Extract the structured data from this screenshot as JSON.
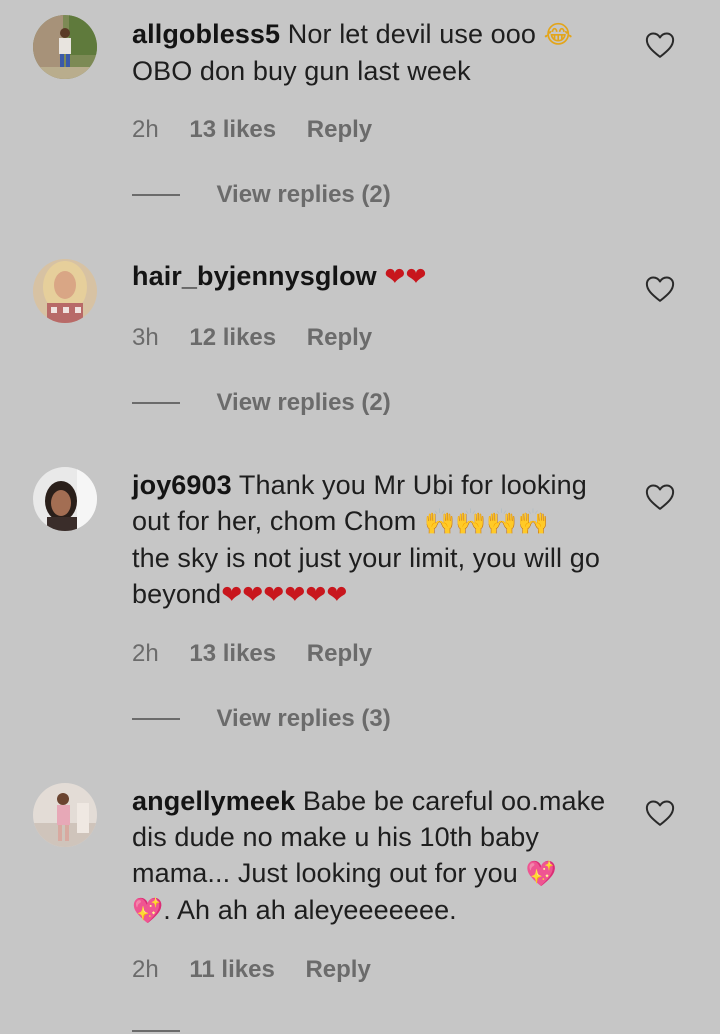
{
  "comments": [
    {
      "username": "allgobless5",
      "lines": [
        "Nor let devil use ooo",
        "OBO don buy gun last week"
      ],
      "emoji": "😂",
      "time": "2h",
      "likes": "13 likes",
      "reply": "Reply",
      "view_replies": "View replies (2)"
    },
    {
      "username": "hair_byjennysglow",
      "emoji": "❤❤",
      "time": "3h",
      "likes": "12 likes",
      "reply": "Reply",
      "view_replies": "View replies (2)"
    },
    {
      "username": "joy6903",
      "line1": "Thank you Mr Ubi for looking",
      "line2": "out for her, chom Chom",
      "line2_emoji": "🙌🙌🙌🙌",
      "line3": "the sky is not just your limit, you will go",
      "line4": "beyond",
      "line4_emoji": "❤❤❤❤❤❤",
      "time": "2h",
      "likes": "13 likes",
      "reply": "Reply",
      "view_replies": "View replies (3)"
    },
    {
      "username": "angellymeek",
      "line1": "Babe be careful oo.make",
      "line2": "dis dude no make u his 10th baby",
      "line3": "mama... Just looking out for you",
      "line3_emoji": "💖",
      "line4_emoji": "💖",
      "line4": ". Ah ah ah aleyeeeeeee.",
      "time": "2h",
      "likes": "11 likes",
      "reply": "Reply"
    }
  ],
  "colors": {
    "background": "#c6c6c6",
    "text": "#1e1e1e",
    "meta": "#6b6b6b",
    "heart": "#c8161d"
  },
  "icons": [
    "heart-outline-icon",
    "avatar-image"
  ]
}
